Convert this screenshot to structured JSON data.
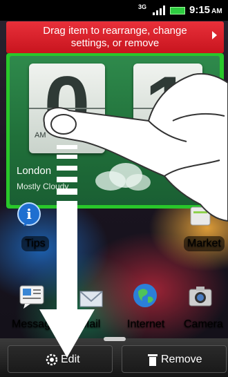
{
  "status": {
    "network": "3G",
    "time": "9:15",
    "ampm": "AM",
    "battery_color": "#2ecc40"
  },
  "banner": {
    "line1": "Drag item to rearrange, change",
    "line2": "settings, or remove",
    "color": "#d21f28"
  },
  "clock_widget": {
    "hour_digit": "0",
    "minute_digit": "1",
    "ampm": "AM",
    "city": "London",
    "condition": "Mostly Cloudy",
    "selection_color": "#29c72a"
  },
  "apps": {
    "tips": "Tips",
    "market": "Market",
    "messages": "Messages",
    "mail": "Mail",
    "internet": "Internet",
    "camera": "Camera"
  },
  "dock": {
    "edit": "Edit",
    "remove": "Remove"
  }
}
